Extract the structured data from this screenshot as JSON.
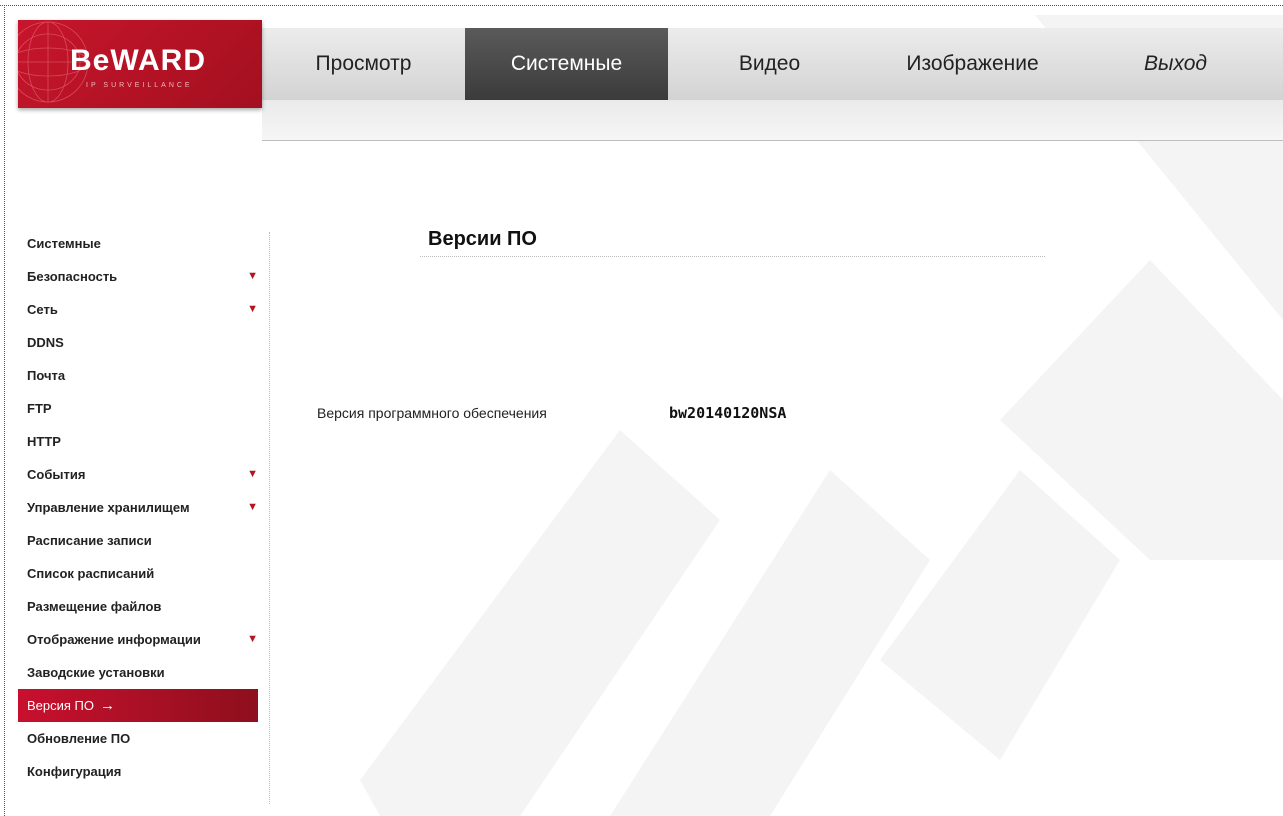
{
  "brand": {
    "logo_text": "BeWARD",
    "tagline": "IP SURVEILLANCE"
  },
  "nav": {
    "items": [
      {
        "label": "Просмотр",
        "active": false
      },
      {
        "label": "Системные",
        "active": true
      },
      {
        "label": "Видео",
        "active": false
      },
      {
        "label": "Изображение",
        "active": false
      },
      {
        "label": "Выход",
        "active": false
      }
    ]
  },
  "sidebar": {
    "items": [
      {
        "label": "Системные",
        "has_submenu": false
      },
      {
        "label": "Безопасность",
        "has_submenu": true
      },
      {
        "label": "Сеть",
        "has_submenu": true
      },
      {
        "label": "DDNS",
        "has_submenu": false
      },
      {
        "label": "Почта",
        "has_submenu": false
      },
      {
        "label": "FTP",
        "has_submenu": false
      },
      {
        "label": "HTTP",
        "has_submenu": false
      },
      {
        "label": "События",
        "has_submenu": true
      },
      {
        "label": "Управление хранилищем",
        "has_submenu": true
      },
      {
        "label": "Расписание записи",
        "has_submenu": false
      },
      {
        "label": "Список расписаний",
        "has_submenu": false
      },
      {
        "label": "Размещение файлов",
        "has_submenu": false
      },
      {
        "label": "Отображение информации",
        "has_submenu": true
      },
      {
        "label": "Заводские установки",
        "has_submenu": false
      },
      {
        "label": "Версия ПО",
        "has_submenu": false,
        "active": true
      },
      {
        "label": "Обновление ПО",
        "has_submenu": false
      },
      {
        "label": "Конфигурация",
        "has_submenu": false
      }
    ],
    "active_arrow": "→",
    "caret": "▼"
  },
  "main": {
    "title": "Версии ПО",
    "firmware_label": "Версия программного обеспечения",
    "firmware_value": "bw20140120NSA"
  },
  "colors": {
    "brand_red": "#c7152c",
    "nav_active": "#4a4a4a",
    "caret_red": "#b3141f"
  }
}
